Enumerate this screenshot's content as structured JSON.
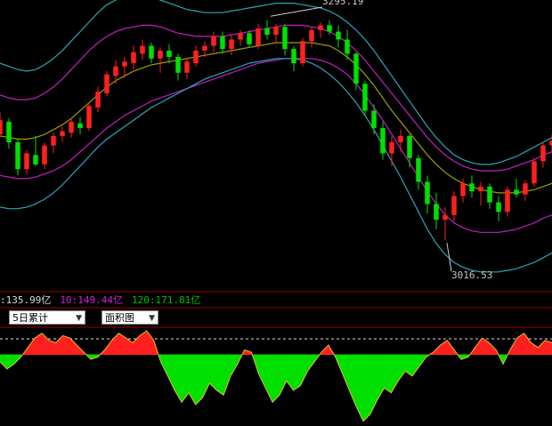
{
  "annotations": {
    "high_label": "3295.19",
    "low_label": "3016.53"
  },
  "indicators": {
    "ma5": ":135.99亿",
    "ma10": "10:149.44亿",
    "ma120": "120:171.81亿"
  },
  "controls": {
    "period_select": "5日累计",
    "chart_type_select": "面积图"
  },
  "colors": {
    "up": "#ff2020",
    "down": "#00e000",
    "outer_band": "#2aa6b8",
    "inner_band": "#c020c0",
    "mid_band": "#a0a000",
    "grid_red": "#a00000",
    "ma5": "#d8d8d8",
    "ma10": "#d020d0",
    "ma120": "#00c000"
  },
  "chart_data": [
    {
      "type": "candlestick",
      "title": "",
      "xlabel": "",
      "ylabel": "",
      "ylim": [
        2960,
        3320
      ],
      "series": [
        {
          "name": "K",
          "values": [
            [
              3150,
              3178,
              3146,
              3168
            ],
            [
              3166,
              3170,
              3132,
              3140
            ],
            [
              3140,
              3145,
              3098,
              3106
            ],
            [
              3106,
              3130,
              3100,
              3126
            ],
            [
              3124,
              3148,
              3110,
              3112
            ],
            [
              3112,
              3140,
              3106,
              3136
            ],
            [
              3136,
              3152,
              3126,
              3148
            ],
            [
              3148,
              3160,
              3140,
              3154
            ],
            [
              3152,
              3170,
              3146,
              3166
            ],
            [
              3164,
              3172,
              3150,
              3158
            ],
            [
              3158,
              3190,
              3154,
              3186
            ],
            [
              3184,
              3210,
              3178,
              3204
            ],
            [
              3202,
              3230,
              3198,
              3226
            ],
            [
              3224,
              3244,
              3214,
              3236
            ],
            [
              3236,
              3248,
              3222,
              3242
            ],
            [
              3240,
              3262,
              3232,
              3254
            ],
            [
              3252,
              3270,
              3244,
              3262
            ],
            [
              3262,
              3266,
              3240,
              3246
            ],
            [
              3246,
              3260,
              3228,
              3256
            ],
            [
              3256,
              3264,
              3240,
              3248
            ],
            [
              3248,
              3252,
              3218,
              3228
            ],
            [
              3228,
              3246,
              3220,
              3242
            ],
            [
              3240,
              3262,
              3236,
              3256
            ],
            [
              3256,
              3268,
              3248,
              3262
            ],
            [
              3262,
              3280,
              3254,
              3274
            ],
            [
              3274,
              3280,
              3252,
              3258
            ],
            [
              3258,
              3276,
              3250,
              3270
            ],
            [
              3270,
              3282,
              3262,
              3278
            ],
            [
              3278,
              3282,
              3260,
              3264
            ],
            [
              3262,
              3290,
              3258,
              3284
            ],
            [
              3284,
              3295,
              3270,
              3276
            ],
            [
              3276,
              3290,
              3266,
              3286
            ],
            [
              3286,
              3290,
              3250,
              3258
            ],
            [
              3258,
              3262,
              3230,
              3240
            ],
            [
              3240,
              3272,
              3236,
              3268
            ],
            [
              3268,
              3286,
              3260,
              3282
            ],
            [
              3282,
              3292,
              3272,
              3288
            ],
            [
              3288,
              3295,
              3276,
              3280
            ],
            [
              3280,
              3288,
              3260,
              3270
            ],
            [
              3270,
              3282,
              3244,
              3252
            ],
            [
              3252,
              3254,
              3206,
              3214
            ],
            [
              3214,
              3218,
              3172,
              3180
            ],
            [
              3180,
              3188,
              3150,
              3158
            ],
            [
              3158,
              3166,
              3118,
              3126
            ],
            [
              3126,
              3148,
              3110,
              3140
            ],
            [
              3140,
              3156,
              3128,
              3148
            ],
            [
              3148,
              3150,
              3108,
              3120
            ],
            [
              3120,
              3124,
              3080,
              3090
            ],
            [
              3090,
              3098,
              3050,
              3062
            ],
            [
              3062,
              3076,
              3030,
              3042
            ],
            [
              3042,
              3058,
              3016,
              3048
            ],
            [
              3048,
              3078,
              3040,
              3072
            ],
            [
              3072,
              3094,
              3064,
              3088
            ],
            [
              3088,
              3098,
              3070,
              3078
            ],
            [
              3078,
              3090,
              3060,
              3084
            ],
            [
              3084,
              3088,
              3056,
              3064
            ],
            [
              3064,
              3072,
              3040,
              3052
            ],
            [
              3052,
              3084,
              3046,
              3080
            ],
            [
              3080,
              3094,
              3070,
              3074
            ],
            [
              3074,
              3092,
              3066,
              3088
            ],
            [
              3088,
              3120,
              3084,
              3116
            ],
            [
              3116,
              3140,
              3108,
              3136
            ],
            [
              3136,
              3150,
              3128,
              3142
            ]
          ]
        },
        {
          "name": "outer_upper",
          "values": [
            3240,
            3236,
            3232,
            3230,
            3232,
            3238,
            3246,
            3256,
            3268,
            3280,
            3292,
            3304,
            3314,
            3320,
            3324,
            3326,
            3326,
            3324,
            3320,
            3316,
            3312,
            3308,
            3306,
            3304,
            3304,
            3304,
            3306,
            3308,
            3310,
            3312,
            3314,
            3316,
            3316,
            3316,
            3314,
            3312,
            3310,
            3306,
            3300,
            3292,
            3282,
            3270,
            3256,
            3240,
            3224,
            3208,
            3192,
            3176,
            3160,
            3146,
            3134,
            3124,
            3118,
            3114,
            3112,
            3112,
            3114,
            3118,
            3122,
            3128,
            3134,
            3140,
            3146
          ]
        },
        {
          "name": "inner_upper",
          "values": [
            3200,
            3196,
            3194,
            3194,
            3196,
            3202,
            3210,
            3220,
            3232,
            3244,
            3256,
            3266,
            3274,
            3280,
            3284,
            3286,
            3288,
            3288,
            3286,
            3282,
            3278,
            3276,
            3274,
            3274,
            3274,
            3274,
            3276,
            3278,
            3280,
            3282,
            3284,
            3286,
            3288,
            3288,
            3288,
            3286,
            3284,
            3280,
            3274,
            3266,
            3256,
            3244,
            3230,
            3216,
            3202,
            3188,
            3174,
            3160,
            3146,
            3134,
            3124,
            3116,
            3110,
            3106,
            3104,
            3104,
            3104,
            3106,
            3110,
            3114,
            3118,
            3124,
            3128
          ]
        },
        {
          "name": "middle",
          "values": [
            3148,
            3146,
            3144,
            3144,
            3146,
            3150,
            3156,
            3162,
            3170,
            3180,
            3190,
            3200,
            3210,
            3218,
            3224,
            3230,
            3234,
            3238,
            3240,
            3242,
            3244,
            3246,
            3248,
            3250,
            3252,
            3254,
            3256,
            3258,
            3260,
            3262,
            3264,
            3266,
            3266,
            3266,
            3266,
            3266,
            3264,
            3262,
            3256,
            3248,
            3238,
            3226,
            3212,
            3196,
            3180,
            3166,
            3152,
            3138,
            3124,
            3112,
            3102,
            3094,
            3088,
            3084,
            3080,
            3078,
            3076,
            3076,
            3076,
            3078,
            3080,
            3084,
            3088
          ]
        },
        {
          "name": "inner_lower",
          "values": [
            3098,
            3096,
            3094,
            3094,
            3096,
            3100,
            3104,
            3110,
            3118,
            3128,
            3138,
            3148,
            3158,
            3166,
            3174,
            3180,
            3186,
            3192,
            3196,
            3200,
            3204,
            3208,
            3212,
            3216,
            3220,
            3224,
            3228,
            3232,
            3236,
            3240,
            3242,
            3244,
            3246,
            3246,
            3246,
            3246,
            3244,
            3240,
            3234,
            3226,
            3214,
            3200,
            3184,
            3168,
            3150,
            3132,
            3114,
            3096,
            3078,
            3062,
            3048,
            3038,
            3032,
            3028,
            3026,
            3026,
            3026,
            3028,
            3030,
            3034,
            3038,
            3044,
            3048
          ]
        },
        {
          "name": "outer_lower",
          "values": [
            3058,
            3056,
            3056,
            3058,
            3062,
            3068,
            3076,
            3086,
            3098,
            3110,
            3122,
            3134,
            3144,
            3152,
            3160,
            3168,
            3176,
            3184,
            3190,
            3196,
            3202,
            3208,
            3214,
            3220,
            3224,
            3228,
            3232,
            3236,
            3240,
            3242,
            3244,
            3246,
            3246,
            3246,
            3244,
            3240,
            3234,
            3226,
            3216,
            3204,
            3190,
            3174,
            3156,
            3136,
            3116,
            3096,
            3074,
            3052,
            3030,
            3012,
            2998,
            2988,
            2982,
            2978,
            2976,
            2976,
            2976,
            2978,
            2980,
            2984,
            2988,
            2994,
            3000
          ]
        }
      ]
    },
    {
      "type": "area",
      "title": "",
      "xlabel": "",
      "ylabel": "",
      "ylim": [
        -60,
        20
      ],
      "values": [
        -6,
        -12,
        -8,
        -2,
        6,
        14,
        18,
        12,
        10,
        16,
        14,
        8,
        2,
        -4,
        -2,
        4,
        12,
        18,
        14,
        10,
        16,
        20,
        12,
        -6,
        -18,
        -30,
        -40,
        -32,
        -42,
        -36,
        -24,
        -30,
        -34,
        -18,
        -8,
        4,
        2,
        -16,
        -28,
        -40,
        -34,
        -22,
        -30,
        -26,
        -14,
        -6,
        2,
        8,
        -2,
        -16,
        -30,
        -44,
        -56,
        -50,
        -38,
        -28,
        -32,
        -22,
        -14,
        -18,
        -10,
        -2,
        2,
        8,
        12,
        4,
        -4,
        -2,
        6,
        14,
        10,
        4,
        -8,
        4,
        14,
        18,
        10,
        6,
        12,
        10
      ]
    }
  ]
}
